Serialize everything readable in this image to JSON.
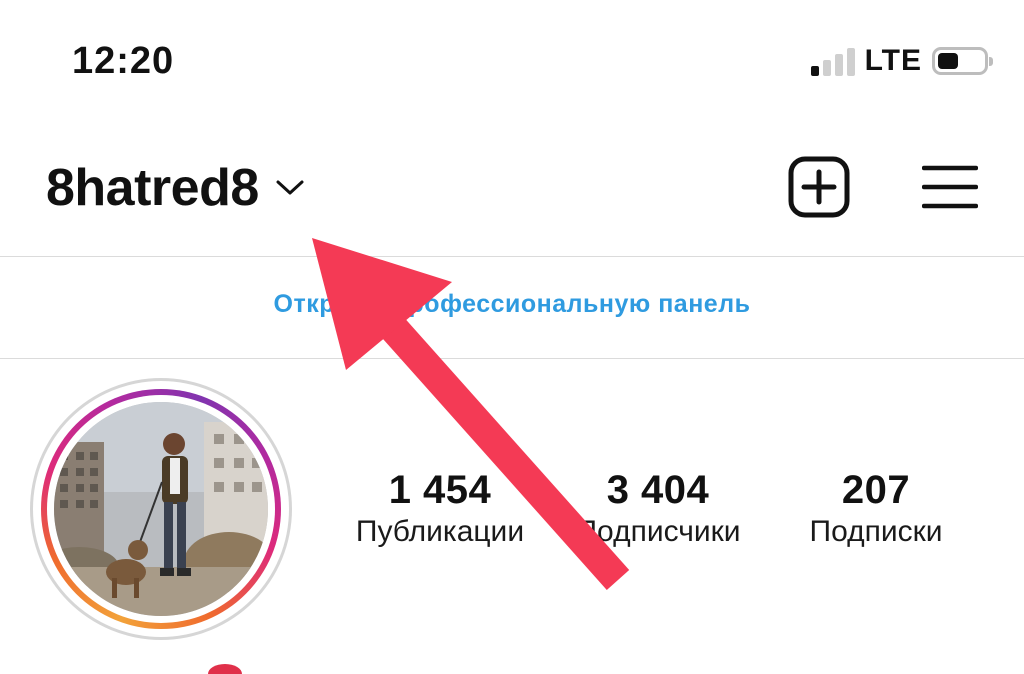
{
  "status_bar": {
    "time": "12:20",
    "network": "LTE",
    "signal_bars_active": 1,
    "signal_bars_total": 4,
    "battery_level": 0.45
  },
  "header": {
    "username": "8hatred8",
    "dropdown_icon": "chevron-down-icon",
    "new_post_icon": "plus-square-icon",
    "menu_icon": "hamburger-menu-icon"
  },
  "pro_panel": {
    "label": "Открыть профессиональную панель"
  },
  "profile": {
    "stats": [
      {
        "value": "1 454",
        "label": "Публикации"
      },
      {
        "value": "3 404",
        "label": "Подписчики"
      },
      {
        "value": "207",
        "label": "Подписки"
      }
    ]
  },
  "annotation": {
    "color": "#f43a55"
  },
  "colors": {
    "link": "#2f9be0",
    "text": "#111111",
    "story_ring": [
      "#f2a23a",
      "#ef6a2e",
      "#dd2a7b",
      "#8134af"
    ]
  }
}
